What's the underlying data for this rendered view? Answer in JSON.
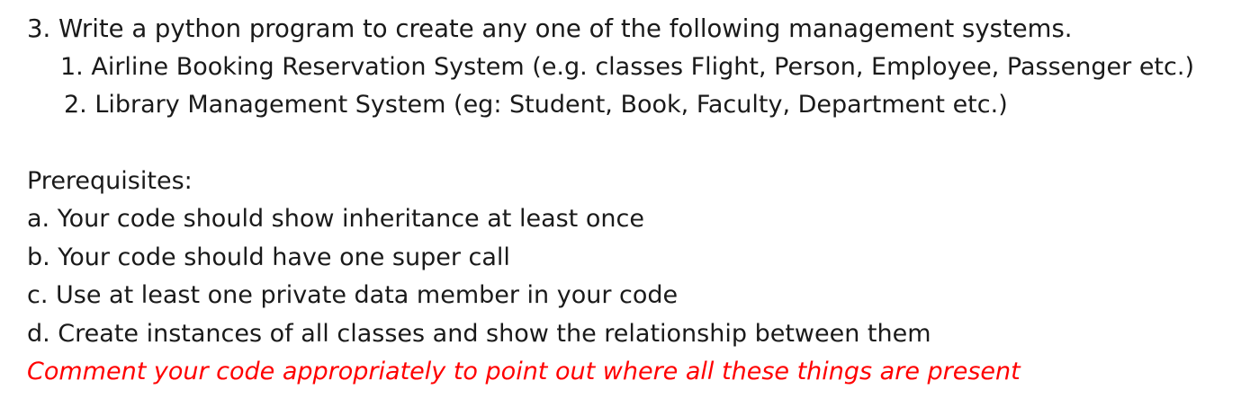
{
  "question": {
    "heading": "3. Write a python program to create any one of the following management systems.",
    "options": [
      "1. Airline Booking Reservation System (e.g. classes Flight, Person, Employee, Passenger etc.)",
      "2. Library Management System (eg: Student, Book, Faculty, Department etc.)"
    ]
  },
  "prerequisites": {
    "title": "Prerequisites:",
    "items": [
      "a. Your code should show inheritance at least once",
      "b. Your code should have one super call",
      "c. Use at least one private data member in your code",
      "d. Create instances of all classes and show the relationship between them"
    ]
  },
  "note": {
    "text": "Comment your code appropriately to point out where all these things are present",
    "color": "#ff0000"
  }
}
